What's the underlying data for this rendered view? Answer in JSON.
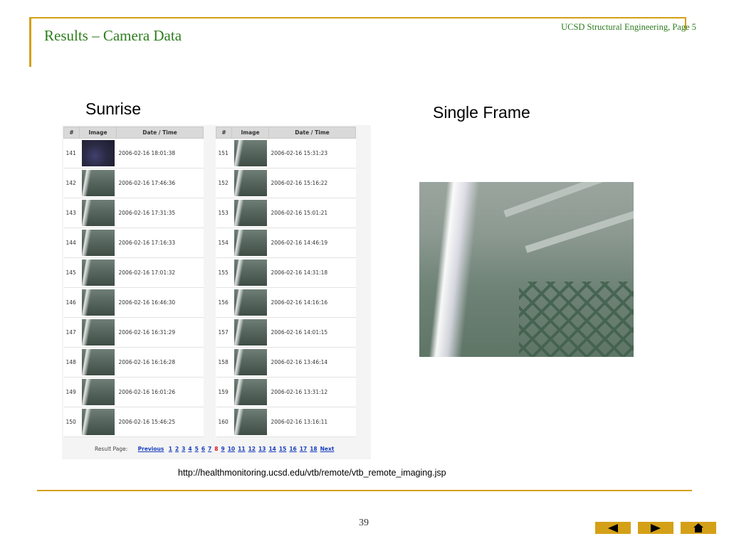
{
  "header": {
    "title": "Results – Camera Data",
    "page_label": "UCSD Structural Engineering, Page 5"
  },
  "labels": {
    "sunrise": "Sunrise",
    "single_frame": "Single Frame"
  },
  "table_headers": {
    "num": "#",
    "image": "Image",
    "datetime": "Date / Time"
  },
  "table_left": [
    {
      "num": "141",
      "datetime": "2006-02-16 18:01:38",
      "thumb": "dark"
    },
    {
      "num": "142",
      "datetime": "2006-02-16 17:46:36",
      "thumb": "frame"
    },
    {
      "num": "143",
      "datetime": "2006-02-16 17:31:35",
      "thumb": "frame"
    },
    {
      "num": "144",
      "datetime": "2006-02-16 17:16:33",
      "thumb": "frame"
    },
    {
      "num": "145",
      "datetime": "2006-02-16 17:01:32",
      "thumb": "frame"
    },
    {
      "num": "146",
      "datetime": "2006-02-16 16:46:30",
      "thumb": "frame"
    },
    {
      "num": "147",
      "datetime": "2006-02-16 16:31:29",
      "thumb": "frame"
    },
    {
      "num": "148",
      "datetime": "2006-02-16 16:16:28",
      "thumb": "frame"
    },
    {
      "num": "149",
      "datetime": "2006-02-16 16:01:26",
      "thumb": "frame"
    },
    {
      "num": "150",
      "datetime": "2006-02-16 15:46:25",
      "thumb": "frame"
    }
  ],
  "table_right": [
    {
      "num": "151",
      "datetime": "2006-02-16 15:31:23",
      "thumb": "frame"
    },
    {
      "num": "152",
      "datetime": "2006-02-16 15:16:22",
      "thumb": "frame"
    },
    {
      "num": "153",
      "datetime": "2006-02-16 15:01:21",
      "thumb": "frame"
    },
    {
      "num": "154",
      "datetime": "2006-02-16 14:46:19",
      "thumb": "frame"
    },
    {
      "num": "155",
      "datetime": "2006-02-16 14:31:18",
      "thumb": "frame"
    },
    {
      "num": "156",
      "datetime": "2006-02-16 14:16:16",
      "thumb": "frame"
    },
    {
      "num": "157",
      "datetime": "2006-02-16 14:01:15",
      "thumb": "frame"
    },
    {
      "num": "158",
      "datetime": "2006-02-16 13:46:14",
      "thumb": "frame"
    },
    {
      "num": "159",
      "datetime": "2006-02-16 13:31:12",
      "thumb": "frame"
    },
    {
      "num": "160",
      "datetime": "2006-02-16 13:16:11",
      "thumb": "frame"
    }
  ],
  "pager": {
    "label": "Result Page:",
    "previous": "Previous",
    "pages": [
      "1",
      "2",
      "3",
      "4",
      "5",
      "6",
      "7",
      "8",
      "9",
      "10",
      "11",
      "12",
      "13",
      "14",
      "15",
      "16",
      "17",
      "18"
    ],
    "current": "8",
    "next": "Next"
  },
  "url": "http://healthmonitoring.ucsd.edu/vtb/remote/vtb_remote_imaging.jsp",
  "page_number": "39",
  "nav_icons": [
    "prev-arrow-icon",
    "next-arrow-icon",
    "home-icon"
  ],
  "colors": {
    "accent": "#d4a017",
    "title": "#2e7d1e",
    "link": "#1a3fbf",
    "current_page": "#dd1122"
  }
}
